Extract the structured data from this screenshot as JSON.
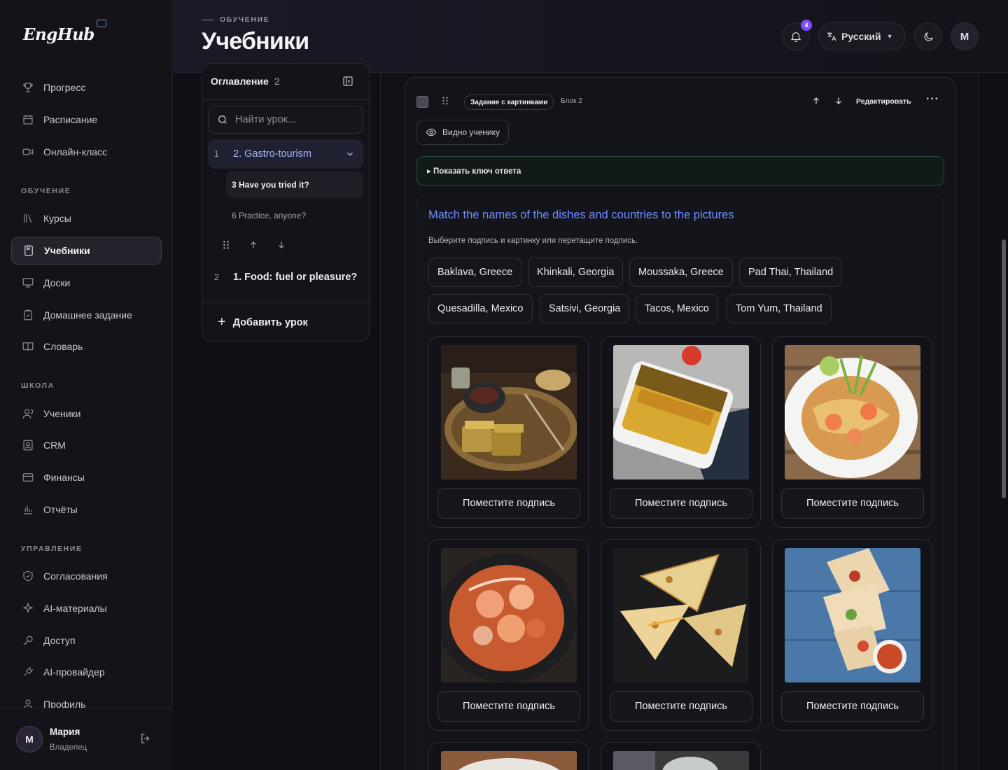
{
  "app": {
    "logo": "EngHub"
  },
  "sidebar": {
    "top_items": [
      {
        "label": "Прогресс",
        "icon": "trophy-icon"
      },
      {
        "label": "Расписание",
        "icon": "calendar-icon"
      },
      {
        "label": "Онлайн-класс",
        "icon": "video-icon"
      }
    ],
    "sections": [
      {
        "label": "ОБУЧЕНИЕ",
        "items": [
          {
            "label": "Курсы",
            "icon": "library-icon"
          },
          {
            "label": "Учебники",
            "icon": "book-icon",
            "active": true
          },
          {
            "label": "Доски",
            "icon": "board-icon"
          },
          {
            "label": "Домашнее задание",
            "icon": "clipboard-icon"
          },
          {
            "label": "Словарь",
            "icon": "dictionary-icon"
          }
        ]
      },
      {
        "label": "ШКОЛА",
        "items": [
          {
            "label": "Ученики",
            "icon": "users-icon"
          },
          {
            "label": "CRM",
            "icon": "crm-icon"
          },
          {
            "label": "Финансы",
            "icon": "wallet-icon"
          },
          {
            "label": "Отчёты",
            "icon": "chart-icon"
          }
        ]
      },
      {
        "label": "УПРАВЛЕНИЕ",
        "items": [
          {
            "label": "Согласования",
            "icon": "shield-icon"
          },
          {
            "label": "AI-материалы",
            "icon": "sparkles-icon"
          },
          {
            "label": "Доступ",
            "icon": "key-icon"
          },
          {
            "label": "AI-провайдер",
            "icon": "plug-icon"
          },
          {
            "label": "Профиль",
            "icon": "user-icon"
          }
        ]
      }
    ],
    "user": {
      "initial": "М",
      "name": "Мария",
      "role": "Владелец"
    }
  },
  "header": {
    "breadcrumb": "ОБУЧЕНИЕ",
    "title": "Учебники",
    "notifications_count": "4",
    "language": "Русский",
    "avatar_initial": "М"
  },
  "toc": {
    "title": "Оглавление",
    "count": "2",
    "search_placeholder": "Найти урок...",
    "lessons": [
      {
        "num": "1",
        "title": "2. Gastro-tourism",
        "sub": [
          "3 Have you tried it?",
          "6 Practice, anyone?"
        ]
      },
      {
        "num": "2",
        "title": "1. Food: fuel or pleasure?"
      }
    ],
    "add_label": "Добавить урок"
  },
  "block": {
    "type_label": "Задание с картинками",
    "block_label": "Блок 2",
    "edit_label": "Редактировать",
    "more_label": "···",
    "visible_label": "Видно ученику",
    "answer_key_label": "▸ Показать ключ ответа",
    "task_title": "Match the names of the dishes and countries to the pictures",
    "task_instruction": "Выберите подпись и картинку или перетащите подпись.",
    "captions": [
      "Baklava, Greece",
      "Khinkali, Georgia",
      "Moussaka, Greece",
      "Pad Thai, Thailand",
      "Quesadilla, Mexico",
      "Satsivi, Georgia",
      "Tacos, Mexico",
      "Tom Yum, Thailand"
    ],
    "placeholder_label": "Поместите подпись",
    "cards": [
      {
        "picture": "baklava-photo"
      },
      {
        "picture": "moussaka-photo"
      },
      {
        "picture": "pad-thai-photo"
      },
      {
        "picture": "tom-yum-photo"
      },
      {
        "picture": "quesadilla-photo"
      },
      {
        "picture": "tacos-photo"
      }
    ]
  },
  "colors": {
    "accent": "#6f8cff",
    "badge": "#7c4dff",
    "background": "#0f0f15"
  }
}
